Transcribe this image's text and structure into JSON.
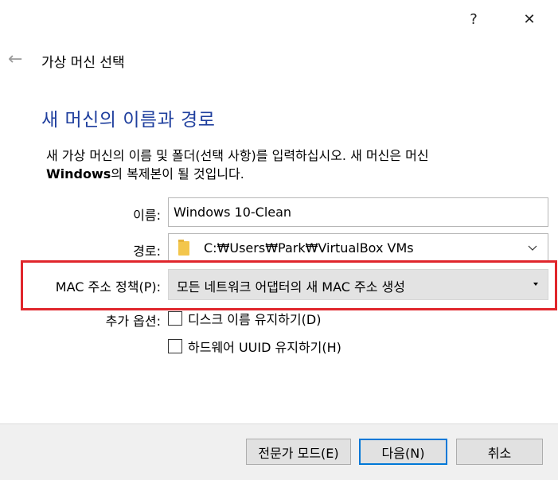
{
  "window": {
    "help_glyph": "?",
    "close_glyph": "✕"
  },
  "header": {
    "back_glyph": "←",
    "title": "가상 머신 선택"
  },
  "page": {
    "heading": "새 머신의 이름과 경로",
    "description_line1": "새 가상 머신의 이름 및 폴더(선택 사항)를 입력하십시오. 새 머신은 머신",
    "description_bold": "Windows",
    "description_line2_rest": "의 복제본이 될 것입니다."
  },
  "form": {
    "name_label": "이름:",
    "name_value": "Windows 10-Clean",
    "path_label": "경로:",
    "path_value": "C:₩Users₩Park₩VirtualBox VMs",
    "mac_label": "MAC 주소 정책(P):",
    "mac_value": "모든 네트워크 어댑터의 새 MAC 주소 생성",
    "extra_label": "추가 옵션:",
    "keep_disk_names": "디스크 이름 유지하기(D)",
    "keep_uuids": "하드웨어 UUID 유지하기(H)"
  },
  "buttons": {
    "expert": "전문가 모드(E)",
    "next": "다음(N)",
    "cancel": "취소"
  },
  "colors": {
    "heading": "#1f3f9e",
    "highlight": "#e0262c",
    "default_button_border": "#0078d7"
  }
}
